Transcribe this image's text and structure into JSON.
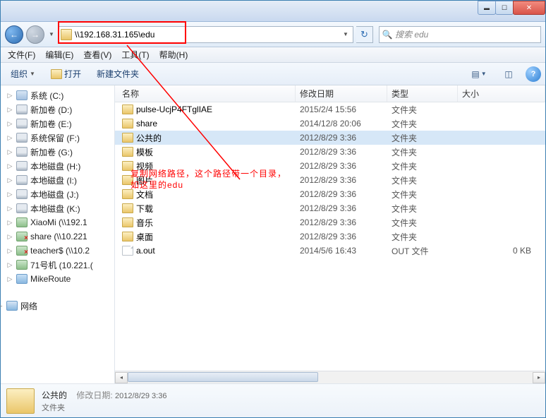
{
  "address": {
    "path": "\\\\192.168.31.165\\edu"
  },
  "search": {
    "placeholder": "搜索 edu"
  },
  "menus": {
    "file": "文件(F)",
    "edit": "编辑(E)",
    "view": "查看(V)",
    "tools": "工具(T)",
    "help": "帮助(H)"
  },
  "toolbar": {
    "organize": "组织",
    "open": "打开",
    "newfolder": "新建文件夹"
  },
  "columns": {
    "name": "名称",
    "date": "修改日期",
    "type": "类型",
    "size": "大小"
  },
  "sidebar": {
    "items": [
      {
        "label": "系统 (C:)",
        "icon": "sys"
      },
      {
        "label": "新加卷 (D:)",
        "icon": "drive"
      },
      {
        "label": "新加卷 (E:)",
        "icon": "drive"
      },
      {
        "label": "系统保留 (F:)",
        "icon": "drive"
      },
      {
        "label": "新加卷 (G:)",
        "icon": "drive"
      },
      {
        "label": "本地磁盘 (H:)",
        "icon": "drive"
      },
      {
        "label": "本地磁盘 (I:)",
        "icon": "drive"
      },
      {
        "label": "本地磁盘 (J:)",
        "icon": "drive"
      },
      {
        "label": "本地磁盘 (K:)",
        "icon": "drive"
      },
      {
        "label": "XiaoMi (\\\\192.1",
        "icon": "netshare"
      },
      {
        "label": "share (\\\\10.221",
        "icon": "netsharex"
      },
      {
        "label": "teacher$ (\\\\10.2",
        "icon": "netsharex"
      },
      {
        "label": "71号机 (10.221.(",
        "icon": "netshare"
      },
      {
        "label": "MikeRoute",
        "icon": "router"
      }
    ],
    "network": "网络"
  },
  "files": [
    {
      "name": "pulse-UcjP4FTglIAE",
      "date": "2015/2/4 15:56",
      "type": "文件夹",
      "size": "",
      "kind": "folder"
    },
    {
      "name": "share",
      "date": "2014/12/8 20:06",
      "type": "文件夹",
      "size": "",
      "kind": "folder"
    },
    {
      "name": "公共的",
      "date": "2012/8/29 3:36",
      "type": "文件夹",
      "size": "",
      "kind": "folder",
      "selected": true
    },
    {
      "name": "模板",
      "date": "2012/8/29 3:36",
      "type": "文件夹",
      "size": "",
      "kind": "folder"
    },
    {
      "name": "视频",
      "date": "2012/8/29 3:36",
      "type": "文件夹",
      "size": "",
      "kind": "folder"
    },
    {
      "name": "图片",
      "date": "2012/8/29 3:36",
      "type": "文件夹",
      "size": "",
      "kind": "folder"
    },
    {
      "name": "文档",
      "date": "2012/8/29 3:36",
      "type": "文件夹",
      "size": "",
      "kind": "folder"
    },
    {
      "name": "下载",
      "date": "2012/8/29 3:36",
      "type": "文件夹",
      "size": "",
      "kind": "folder"
    },
    {
      "name": "音乐",
      "date": "2012/8/29 3:36",
      "type": "文件夹",
      "size": "",
      "kind": "folder"
    },
    {
      "name": "桌面",
      "date": "2012/8/29 3:36",
      "type": "文件夹",
      "size": "",
      "kind": "folder"
    },
    {
      "name": "a.out",
      "date": "2014/5/6 16:43",
      "type": "OUT 文件",
      "size": "0 KB",
      "kind": "file"
    }
  ],
  "details": {
    "name": "公共的",
    "date_label": "修改日期:",
    "date": "2012/8/29 3:36",
    "type": "文件夹"
  },
  "annotation": {
    "line1": "复制网络路径，这个路径带一个目录，",
    "line2": "如这里的edu"
  }
}
